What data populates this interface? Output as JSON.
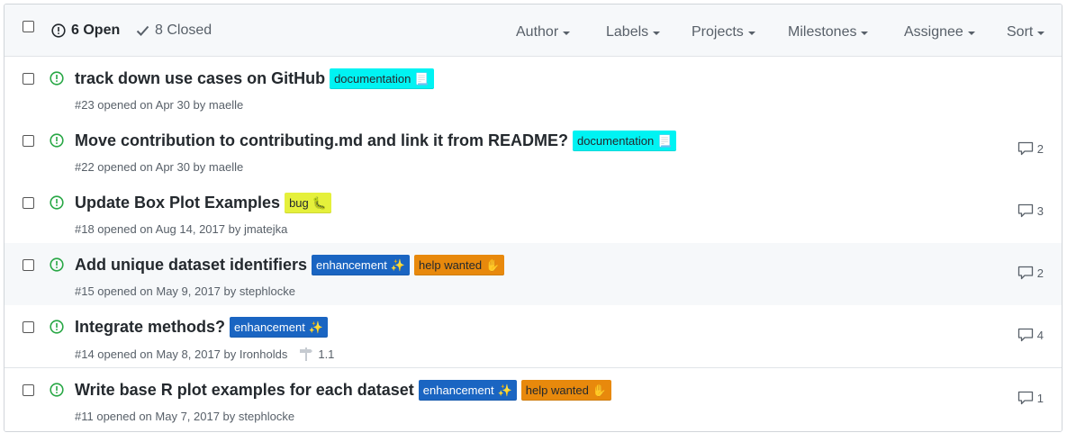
{
  "header": {
    "open_label": "6 Open",
    "closed_label": "8 Closed",
    "filters": [
      "Author",
      "Labels",
      "Projects",
      "Milestones",
      "Assignee",
      "Sort"
    ]
  },
  "colors": {
    "open_green": "#28a745",
    "documentation": "#00f3f3",
    "bug": "#e5f03b",
    "enhancement": "#1a65c2",
    "help_wanted": "#e8890c"
  },
  "issues": [
    {
      "title": "track down use cases on GitHub",
      "meta": "#23 opened on Apr 30 by maelle",
      "labels": [
        {
          "name": "documentation",
          "emoji_icon": "page-icon",
          "emoji": "📃",
          "bg": "#00f3f3",
          "fg": "#24292e"
        }
      ],
      "comments": "",
      "milestone": ""
    },
    {
      "title": "Move contribution to contributing.md and link it from README?",
      "meta": "#22 opened on Apr 30 by maelle",
      "labels": [
        {
          "name": "documentation",
          "emoji_icon": "page-icon",
          "emoji": "📃",
          "bg": "#00f3f3",
          "fg": "#24292e"
        }
      ],
      "comments": "2",
      "milestone": ""
    },
    {
      "title": "Update Box Plot Examples",
      "meta": "#18 opened on Aug 14, 2017 by jmatejka",
      "labels": [
        {
          "name": "bug",
          "emoji_icon": "bug-icon",
          "emoji": "🐛",
          "bg": "#e5f03b",
          "fg": "#24292e"
        }
      ],
      "comments": "3",
      "milestone": ""
    },
    {
      "title": "Add unique dataset identifiers",
      "meta": "#15 opened on May 9, 2017 by stephlocke",
      "labels": [
        {
          "name": "enhancement",
          "emoji_icon": "sparkles-icon",
          "emoji": "✨",
          "bg": "#1a65c2",
          "fg": "#ffffff"
        },
        {
          "name": "help wanted",
          "emoji_icon": "raised-hand-icon",
          "emoji": "✋",
          "bg": "#e8890c",
          "fg": "#24292e"
        }
      ],
      "comments": "2",
      "milestone": ""
    },
    {
      "title": "Integrate methods?",
      "meta": "#14 opened on May 8, 2017 by Ironholds",
      "labels": [
        {
          "name": "enhancement",
          "emoji_icon": "sparkles-icon",
          "emoji": "✨",
          "bg": "#1a65c2",
          "fg": "#ffffff"
        }
      ],
      "comments": "4",
      "milestone": "1.1"
    },
    {
      "title": "Write base R plot examples for each dataset",
      "meta": "#11 opened on May 7, 2017 by stephlocke",
      "labels": [
        {
          "name": "enhancement",
          "emoji_icon": "sparkles-icon",
          "emoji": "✨",
          "bg": "#1a65c2",
          "fg": "#ffffff"
        },
        {
          "name": "help wanted",
          "emoji_icon": "raised-hand-icon",
          "emoji": "✋",
          "bg": "#e8890c",
          "fg": "#24292e"
        }
      ],
      "comments": "1",
      "milestone": ""
    }
  ]
}
